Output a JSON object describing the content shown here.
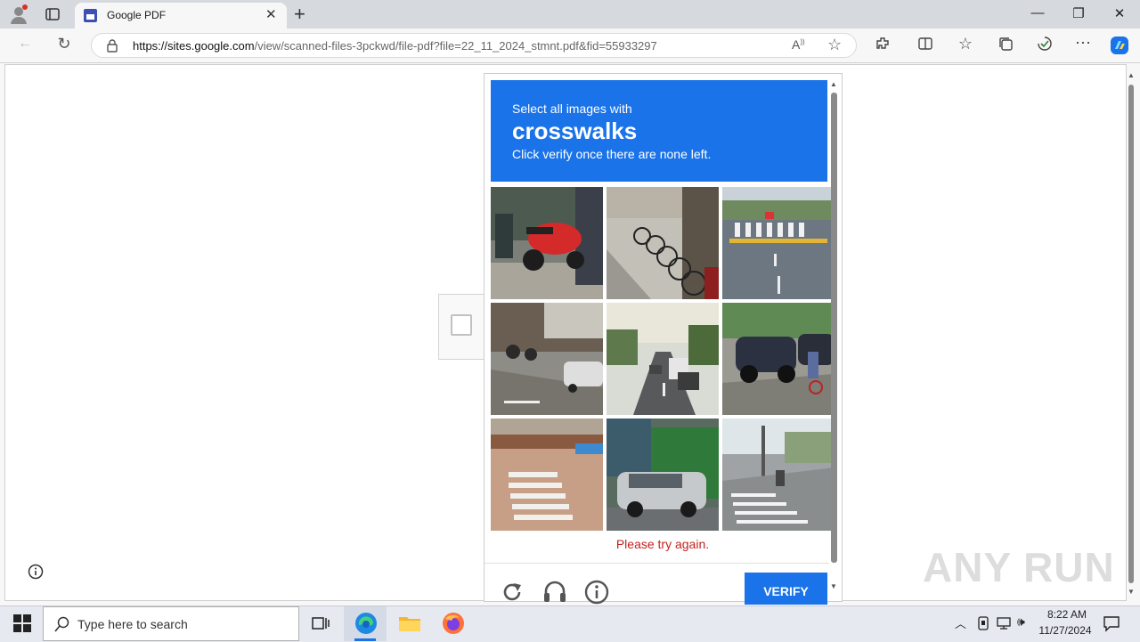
{
  "browser": {
    "tab_title": "Google PDF",
    "url_domain": "https://sites.google.com",
    "url_path": "/view/scanned-files-3pckwd/file-pdf?file=22_11_2024_stmnt.pdf&fid=55933297"
  },
  "captcha": {
    "instruction": "Select all images with",
    "target": "crosswalks",
    "hint": "Click verify once there are none left.",
    "error": "Please try again.",
    "verify_label": "VERIFY",
    "tiles": [
      "red scooter on sidewalk",
      "parked bicycles",
      "road with zebra crosswalk",
      "street with motorbikes",
      "traffic on city road",
      "parked SUV and cyclist",
      "zebra crossing at corner",
      "silver car by truck",
      "intersection crosswalk"
    ],
    "accent_color": "#1a73e8"
  },
  "taskbar": {
    "search_placeholder": "Type here to search",
    "time": "8:22 AM",
    "date": "11/27/2024"
  },
  "watermark": "ANY RUN"
}
